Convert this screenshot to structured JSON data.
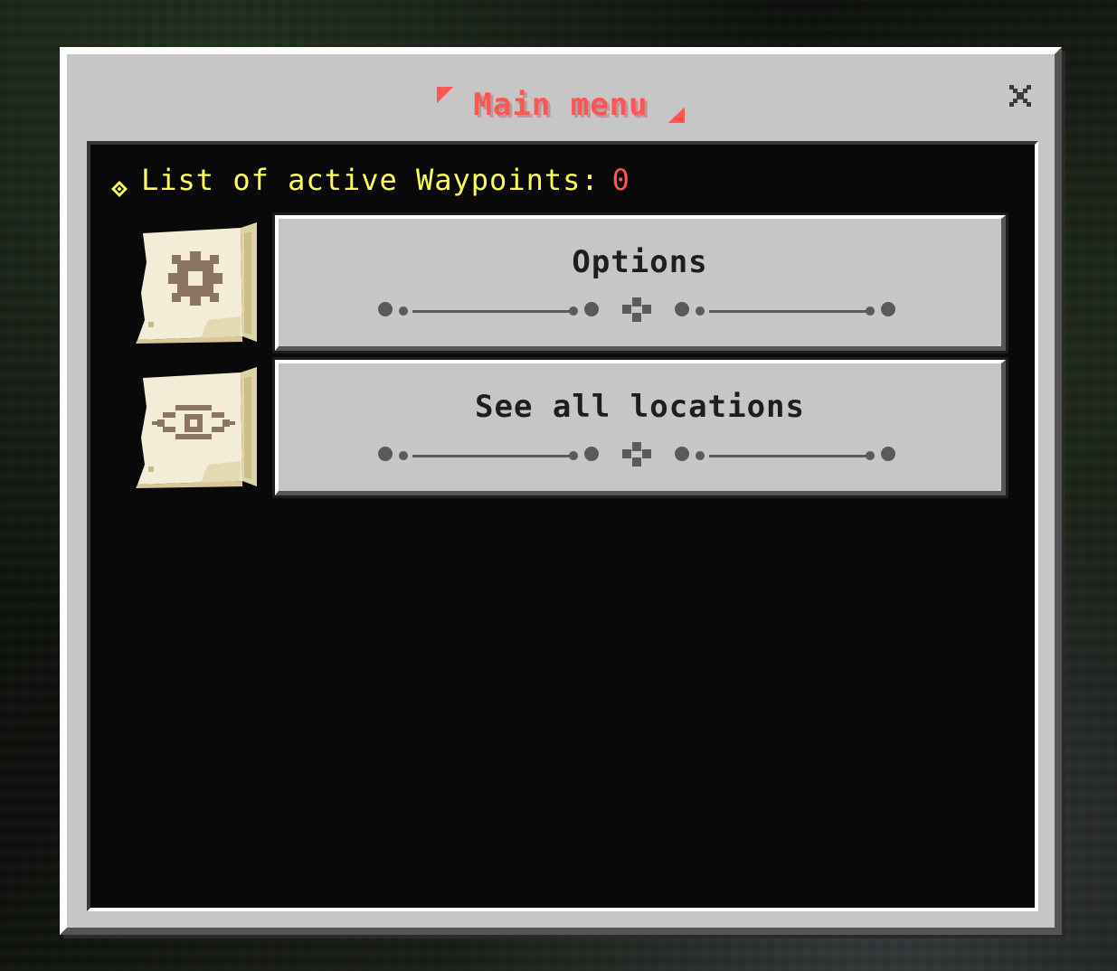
{
  "window": {
    "title": "Main menu"
  },
  "waypoints": {
    "label": "List of active Waypoints:",
    "count": "0"
  },
  "menu": {
    "items": [
      {
        "label": "Options",
        "icon": "gear-scroll-icon"
      },
      {
        "label": "See all locations",
        "icon": "eye-scroll-icon"
      }
    ]
  },
  "colors": {
    "title": "#ff5555",
    "waypoints_label": "#ffff55",
    "waypoints_count": "#ff5555",
    "panel_bg": "#090909",
    "button_bg": "#c6c6c6"
  }
}
